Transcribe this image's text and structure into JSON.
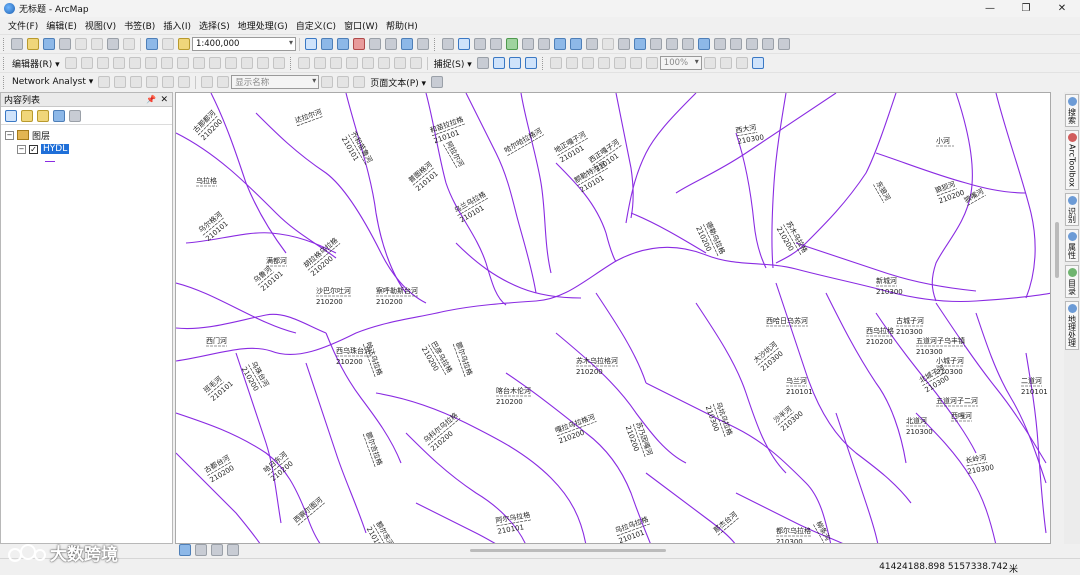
{
  "window": {
    "title": "无标题 - ArcMap"
  },
  "menu": [
    "文件(F)",
    "编辑(E)",
    "视图(V)",
    "书签(B)",
    "插入(I)",
    "选择(S)",
    "地理处理(G)",
    "自定义(C)",
    "窗口(W)",
    "帮助(H)"
  ],
  "toolbar": {
    "scale": "1:400,000",
    "editor_label": "编辑器(R) ▾",
    "snapping_label": "捕捉(S) ▾",
    "zoom_percent": "100%",
    "network_analyst": "Network Analyst ▾",
    "display_name": "显示名称",
    "page_text": "页面文本(P) ▾"
  },
  "toc": {
    "title": "内容列表",
    "group": "图层",
    "layer": "HYDL"
  },
  "dock_tabs": [
    "搜索",
    "ArcToolbox",
    "识别",
    "属性",
    "目录",
    "地理处理"
  ],
  "status": {
    "coords": "41424188.898  5157338.742",
    "unit": "米"
  },
  "watermark": "大数跨境",
  "colors": {
    "river": "#8a2be2",
    "selection": "#1f6fd8"
  },
  "map": {
    "labels": [
      {
        "name": "古那都河",
        "code": "210200"
      },
      {
        "name": "达拉尔河",
        "code": ""
      },
      {
        "name": "齐和苗鲁河",
        "code": "210101"
      },
      {
        "name": "和苗拉拉格",
        "code": "210101"
      },
      {
        "name": "阿拉尔河",
        "code": ""
      },
      {
        "name": "哈尔哈拉格河",
        "code": ""
      },
      {
        "name": "地正嘎子河",
        "code": "210101"
      },
      {
        "name": "西正嘎子河",
        "code": "210101"
      },
      {
        "name": "额勒特沟河",
        "code": "210101"
      },
      {
        "name": "普图格河",
        "code": "210101"
      },
      {
        "name": "乌兰乌拉格",
        "code": "210101"
      },
      {
        "name": "西大河",
        "code": "210300"
      },
      {
        "name": "小河",
        "code": ""
      },
      {
        "name": "东狼河",
        "code": ""
      },
      {
        "name": "狼狈河",
        "code": "210200"
      },
      {
        "name": "狼嘴河",
        "code": ""
      },
      {
        "name": "德勒乌拉格",
        "code": "210200"
      },
      {
        "name": "苏木乌拉格",
        "code": "210200"
      },
      {
        "name": "乌拉格",
        "code": ""
      },
      {
        "name": "乌尔格河",
        "code": "210101"
      },
      {
        "name": "沙巴尔吐河",
        "code": "210200"
      },
      {
        "name": "察呼勒斯台河",
        "code": "210200"
      },
      {
        "name": "胡拉格乌拉格",
        "code": "210200"
      },
      {
        "name": "满都河",
        "code": ""
      },
      {
        "name": "乌鲁河",
        "code": "210101"
      },
      {
        "name": "西门河",
        "code": ""
      },
      {
        "name": "乌珠台河",
        "code": "210200"
      },
      {
        "name": "西乌珠台河",
        "code": "210200"
      },
      {
        "name": "哈达乌拉格",
        "code": ""
      },
      {
        "name": "巴彦乌拉格",
        "code": "210200"
      },
      {
        "name": "额尔乌拉格",
        "code": ""
      },
      {
        "name": "苏木乌拉格河",
        "code": "210200"
      },
      {
        "name": "乌兰河",
        "code": "210101"
      },
      {
        "name": "西哈日乌苏河",
        "code": ""
      },
      {
        "name": "西乌拉格",
        "code": "210200"
      },
      {
        "name": "五道河子乌丰镇",
        "code": "210300"
      },
      {
        "name": "古城子河",
        "code": "210300"
      },
      {
        "name": "新城河",
        "code": "210300"
      },
      {
        "name": "小城子河",
        "code": "210300"
      },
      {
        "name": "北城子河",
        "code": "210300"
      },
      {
        "name": "五道河子二河",
        "code": ""
      },
      {
        "name": "西嘎河",
        "code": ""
      },
      {
        "name": "大沙坑河",
        "code": "210300"
      },
      {
        "name": "乌坑乌拉格",
        "code": "210300"
      },
      {
        "name": "沙半河",
        "code": "210300"
      },
      {
        "name": "喀台木伦河",
        "code": "210200"
      },
      {
        "name": "额尔吉拉格",
        "code": ""
      },
      {
        "name": "乌科尔乌拉格",
        "code": "210200"
      },
      {
        "name": "嘎拉乌拉格河",
        "code": "210200"
      },
      {
        "name": "苏乃因嘎河",
        "code": "210200"
      },
      {
        "name": "班毛河",
        "code": "210101"
      },
      {
        "name": "古都台河",
        "code": "210200"
      },
      {
        "name": "哈日东河",
        "code": "210200"
      },
      {
        "name": "西察尔图河",
        "code": ""
      },
      {
        "name": "额尔东河",
        "code": "210101"
      },
      {
        "name": "阿尔乌拉格",
        "code": "210101"
      },
      {
        "name": "乌拉乌拉格",
        "code": "210101"
      },
      {
        "name": "那杰台河",
        "code": ""
      },
      {
        "name": "都尔乌拉格",
        "code": "210300"
      },
      {
        "name": "柳条沟",
        "code": ""
      },
      {
        "name": "北道河",
        "code": "210300"
      },
      {
        "name": "长岭河",
        "code": "210300"
      },
      {
        "name": "二道河",
        "code": "210101"
      }
    ]
  }
}
